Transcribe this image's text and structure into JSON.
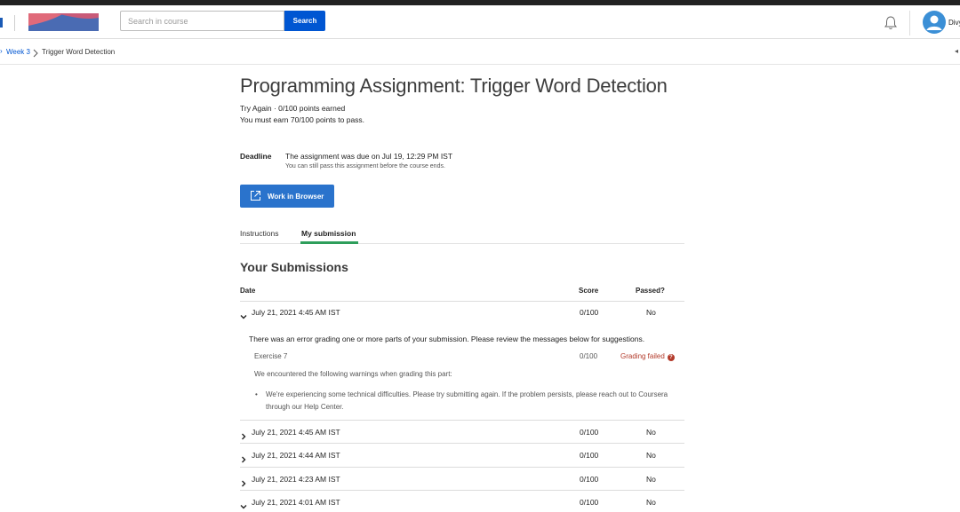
{
  "header": {
    "search_placeholder": "Search in course",
    "search_button": "Search",
    "username": "Divy"
  },
  "breadcrumb": {
    "week": "Week 3",
    "current": "Trigger Word Detection"
  },
  "assignment": {
    "title": "Programming Assignment: Trigger Word Detection",
    "status": "Try Again · 0/100 points earned",
    "pass_requirement": "You must earn 70/100 points to pass.",
    "deadline_label": "Deadline",
    "deadline_text": "The assignment was due on Jul 19, 12:29 PM IST",
    "deadline_sub": "You can still pass this assignment before the course ends.",
    "work_button": "Work in Browser"
  },
  "tabs": {
    "instructions": "Instructions",
    "my_submission": "My submission"
  },
  "submissions": {
    "heading": "Your Submissions",
    "columns": {
      "date": "Date",
      "score": "Score",
      "passed": "Passed?"
    },
    "rows": [
      {
        "date": "July 21, 2021 4:45 AM IST",
        "score": "0/100",
        "passed": "No",
        "expanded": true
      },
      {
        "date": "July 21, 2021 4:45 AM IST",
        "score": "0/100",
        "passed": "No",
        "expanded": false
      },
      {
        "date": "July 21, 2021 4:44 AM IST",
        "score": "0/100",
        "passed": "No",
        "expanded": false
      },
      {
        "date": "July 21, 2021 4:23 AM IST",
        "score": "0/100",
        "passed": "No",
        "expanded": false
      },
      {
        "date": "July 21, 2021 4:01 AM IST",
        "score": "0/100",
        "passed": "No",
        "expanded": true
      }
    ],
    "detail": {
      "error_message": "There was an error grading one or more parts of your submission. Please review the messages below for suggestions.",
      "exercise": "Exercise 7",
      "exercise_score": "0/100",
      "exercise_status": "Grading failed",
      "warning_intro": "We encountered the following warnings when grading this part:",
      "warning_text": "We're experiencing some technical difficulties. Please try submitting again. If the problem persists, please reach out to Coursera through our Help Center."
    }
  },
  "colors": {
    "primary": "#0056d2",
    "button": "#2a73cc",
    "tab_accent": "#2e9e5b",
    "error": "#b33a2a"
  },
  "icons": [
    "bell-icon",
    "avatar-icon",
    "external-link-icon",
    "chevron-right-icon",
    "chevron-down-icon",
    "help-circle-icon"
  ]
}
